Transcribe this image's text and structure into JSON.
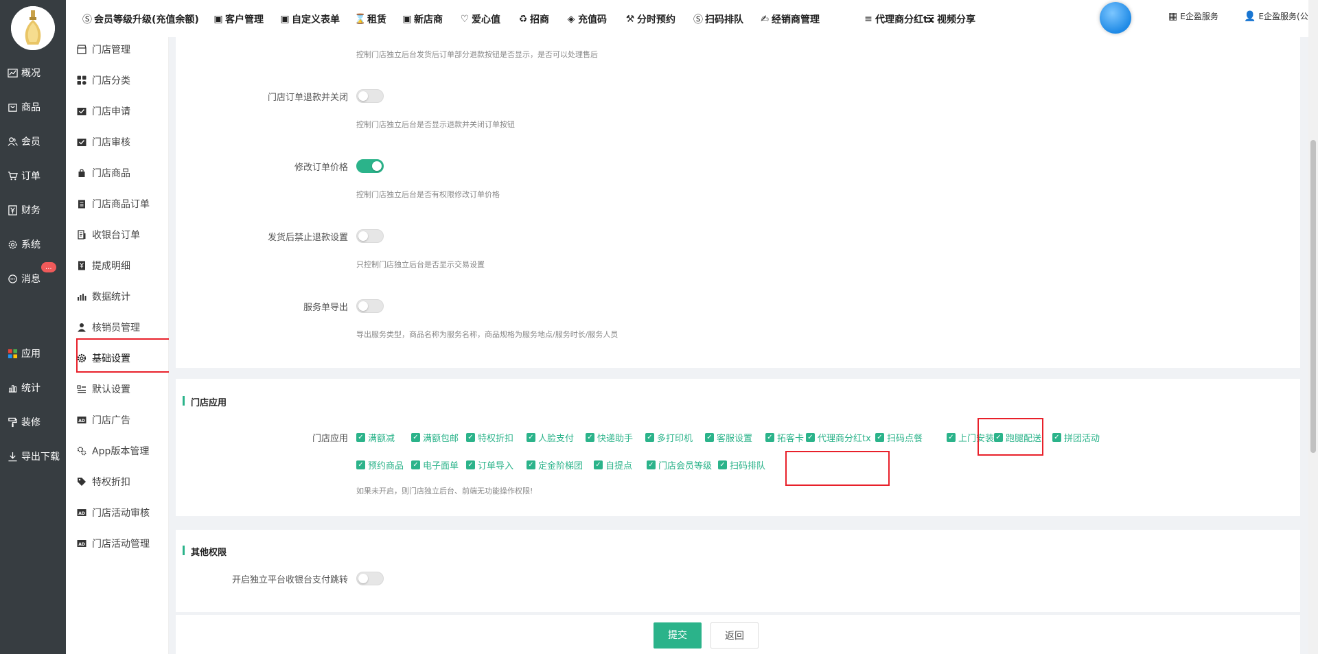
{
  "left_nav": {
    "items": [
      {
        "label": "概况",
        "icon": "chart-line-icon"
      },
      {
        "label": "商品",
        "icon": "shopping-bag-icon"
      },
      {
        "label": "会员",
        "icon": "users-icon"
      },
      {
        "label": "订单",
        "icon": "cart-icon"
      },
      {
        "label": "财务",
        "icon": "yen-icon"
      },
      {
        "label": "系统",
        "icon": "gear-icon"
      },
      {
        "label": "消息",
        "icon": "message-icon"
      },
      {
        "label": "应用",
        "icon": "apps-grid-icon"
      },
      {
        "label": "统计",
        "icon": "bar-chart-icon"
      },
      {
        "label": "装修",
        "icon": "paint-roller-icon"
      },
      {
        "label": "导出下载",
        "icon": "download-icon"
      }
    ],
    "message_badge": "..."
  },
  "sub_nav": {
    "items": [
      {
        "label": "门店管理",
        "icon": "store-icon"
      },
      {
        "label": "门店分类",
        "icon": "category-icon"
      },
      {
        "label": "门店申请",
        "icon": "inbox-check-icon"
      },
      {
        "label": "门店审核",
        "icon": "inbox-check-icon"
      },
      {
        "label": "门店商品",
        "icon": "bag-icon"
      },
      {
        "label": "门店商品订单",
        "icon": "clipboard-icon"
      },
      {
        "label": "收银台订单",
        "icon": "receipt-icon"
      },
      {
        "label": "提成明细",
        "icon": "yen-note-icon"
      },
      {
        "label": "数据统计",
        "icon": "stats-icon"
      },
      {
        "label": "核销员管理",
        "icon": "user-icon"
      },
      {
        "label": "基础设置",
        "icon": "gear-icon"
      },
      {
        "label": "默认设置",
        "icon": "list-settings-icon"
      },
      {
        "label": "门店广告",
        "icon": "ad-icon"
      },
      {
        "label": "App版本管理",
        "icon": "gears-icon"
      },
      {
        "label": "特权折扣",
        "icon": "tag-icon"
      },
      {
        "label": "门店活动审核",
        "icon": "ad-icon"
      },
      {
        "label": "门店活动管理",
        "icon": "ad-icon"
      }
    ],
    "active_index": 10
  },
  "topbar": {
    "items": [
      {
        "label": "会员等级升级(充值余额)",
        "icon": "skype-icon"
      },
      {
        "label": "客户管理",
        "icon": "window-icon"
      },
      {
        "label": "自定义表单",
        "icon": "window-icon"
      },
      {
        "label": "租赁",
        "icon": "hourglass-icon"
      },
      {
        "label": "新店商",
        "icon": "window-icon"
      },
      {
        "label": "爱心值",
        "icon": "heart-icon"
      },
      {
        "label": "招商",
        "icon": "recycle-icon"
      },
      {
        "label": "充值码",
        "icon": "tag-icon"
      },
      {
        "label": "分时预约",
        "icon": "gavel-icon"
      },
      {
        "label": "扫码排队",
        "icon": "skype-icon"
      },
      {
        "label": "经销商管理",
        "icon": "handshake-icon"
      },
      {
        "label": "代理商分红tx",
        "icon": "menu-icon"
      },
      {
        "label": "视频分享",
        "icon": "list-icon"
      }
    ],
    "service_label": "E企盈服务",
    "user_label": "E企盈服务(公众号管理员)"
  },
  "settings": {
    "top_hint": "控制门店独立后台发货后订单部分退款按钮是否显示，是否可以处理售后",
    "rows": [
      {
        "label": "门店订单退款并关闭",
        "on": false,
        "hint": "控制门店独立后台是否显示退款并关闭订单按钮"
      },
      {
        "label": "修改订单价格",
        "on": true,
        "hint": "控制门店独立后台是否有权限修改订单价格"
      },
      {
        "label": "发货后禁止退款设置",
        "on": false,
        "hint": "只控制门店独立后台是否显示交易设置"
      },
      {
        "label": "服务单导出",
        "on": false,
        "hint": "导出服务类型，商品名称为服务名称，商品规格为服务地点/服务时长/服务人员"
      }
    ]
  },
  "store_apps": {
    "section_title": "门店应用",
    "label": "门店应用",
    "row1": [
      "满额减",
      "满额包邮",
      "特权折扣",
      "人脸支付",
      "快递助手",
      "多打印机",
      "客服设置",
      "拓客卡",
      "代理商分红tx",
      "扫码点餐",
      "上门安装",
      "跑腿配送",
      "拼团活动"
    ],
    "row2": [
      "预约商品",
      "电子面单",
      "订单导入",
      "定金阶梯团",
      "自提点",
      "门店会员等级",
      "扫码排队"
    ],
    "hint": "如果未开启，则门店独立后台、前端无功能操作权限!"
  },
  "other": {
    "section_title": "其他权限",
    "row_label": "开启独立平台收银台支付跳转",
    "on": false
  },
  "buttons": {
    "submit": "提交",
    "back": "返回"
  },
  "colors": {
    "accent": "#2bb38a",
    "nav_bg": "#373d41",
    "highlight": "#e8202a"
  }
}
